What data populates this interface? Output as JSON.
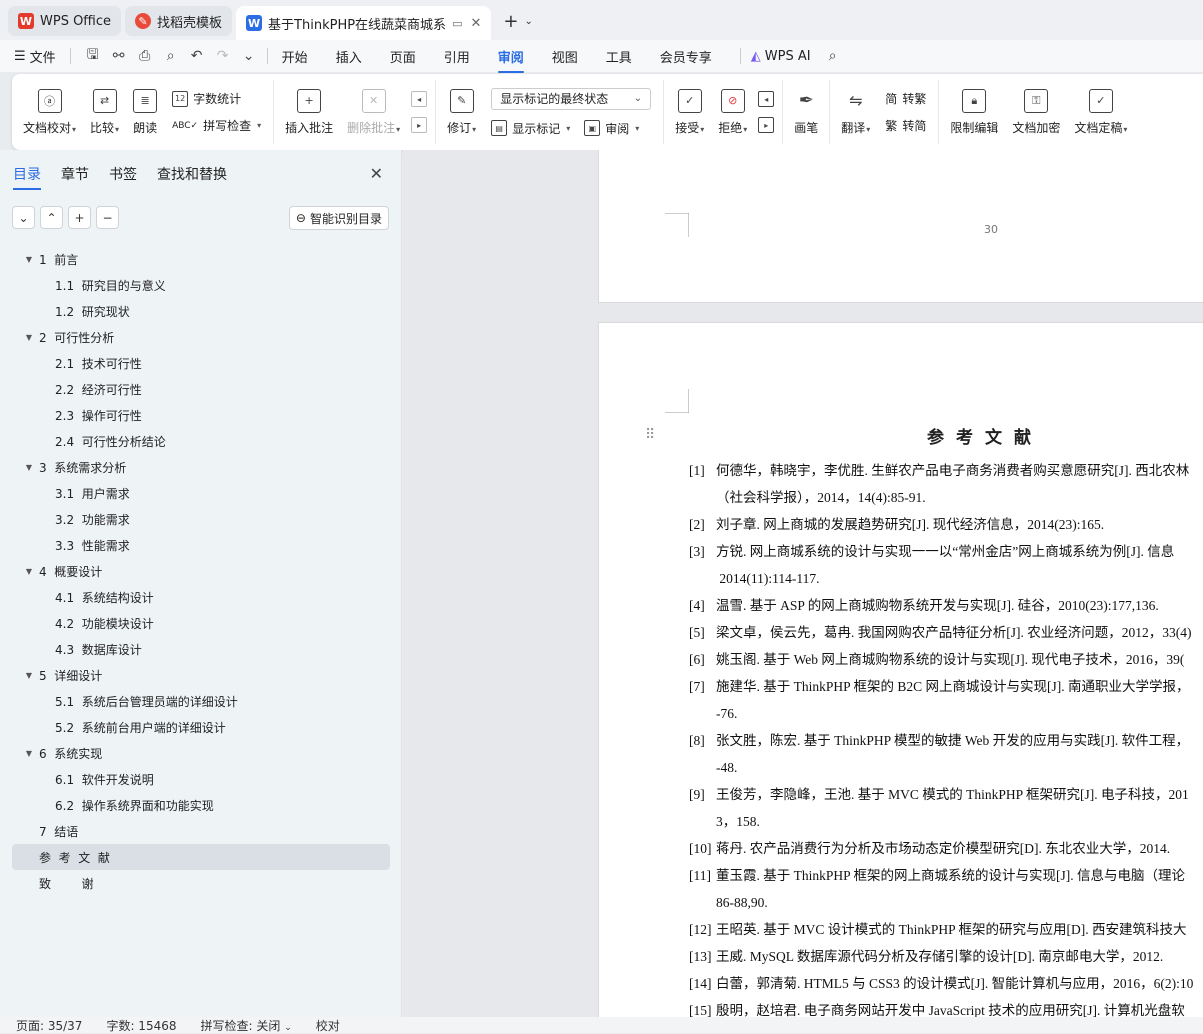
{
  "tabs": [
    {
      "label": "WPS Office",
      "icon": "wps-logo-icon",
      "color": "#e23b2e"
    },
    {
      "label": "找稻壳模板",
      "icon": "docer-icon",
      "color": "#e84b3c"
    },
    {
      "label": "基于ThinkPHP在线蔬菜商城系",
      "icon": "word-doc-icon",
      "color": "#2b6de5",
      "active": true
    }
  ],
  "menu": {
    "file_label": "文件",
    "tabs": [
      "开始",
      "插入",
      "页面",
      "引用",
      "审阅",
      "视图",
      "工具",
      "会员专享"
    ],
    "selected_tab": "审阅",
    "ai_label": "WPS AI"
  },
  "ribbon": {
    "proof_label": "文档校对",
    "compare_label": "比较",
    "read_label": "朗读",
    "wordcount_label": "字数统计",
    "spellcheck_label": "拼写检查",
    "insert_comment_label": "插入批注",
    "delete_comment_label": "删除批注",
    "revise_label": "修订",
    "markup_select": "显示标记的最终状态",
    "show_markup_label": "显示标记",
    "review_label": "审阅",
    "accept_label": "接受",
    "reject_label": "拒绝",
    "pen_label": "画笔",
    "translate_label": "翻译",
    "to_trad_label": "转繁",
    "to_simp_label": "转简",
    "restrict_label": "限制编辑",
    "encrypt_label": "文档加密",
    "finalize_label": "文档定稿"
  },
  "sidebar": {
    "tabs": [
      "目录",
      "章节",
      "书签",
      "查找和替换"
    ],
    "selected_tab": "目录",
    "smart_label": "智能识别目录",
    "toc": [
      {
        "label": "1  前言",
        "level": 1
      },
      {
        "label": "1.1  研究目的与意义",
        "level": 2
      },
      {
        "label": "1.2  研究现状",
        "level": 2
      },
      {
        "label": "2  可行性分析",
        "level": 1
      },
      {
        "label": "2.1  技术可行性",
        "level": 2
      },
      {
        "label": "2.2  经济可行性",
        "level": 2
      },
      {
        "label": "2.3  操作可行性",
        "level": 2
      },
      {
        "label": "2.4  可行性分析结论",
        "level": 2
      },
      {
        "label": "3  系统需求分析",
        "level": 1
      },
      {
        "label": "3.1  用户需求",
        "level": 2
      },
      {
        "label": "3.2  功能需求",
        "level": 2
      },
      {
        "label": "3.3  性能需求",
        "level": 2
      },
      {
        "label": "4  概要设计",
        "level": 1
      },
      {
        "label": "4.1  系统结构设计",
        "level": 2
      },
      {
        "label": "4.2  功能模块设计",
        "level": 2
      },
      {
        "label": "4.3  数据库设计",
        "level": 2
      },
      {
        "label": "5  详细设计",
        "level": 1
      },
      {
        "label": "5.1  系统后台管理员端的详细设计",
        "level": 2
      },
      {
        "label": "5.2  系统前台用户端的详细设计",
        "level": 2
      },
      {
        "label": "6  系统实现",
        "level": 1
      },
      {
        "label": "6.1  软件开发说明",
        "level": 2
      },
      {
        "label": "6.2  操作系统界面和功能实现",
        "level": 2
      },
      {
        "label": "7  结语",
        "level": 1,
        "leaf": true
      },
      {
        "label": "参  考  文  献",
        "level": 1,
        "leaf": true,
        "selected": true
      },
      {
        "label": "致        谢",
        "level": 1,
        "leaf": true
      }
    ]
  },
  "document": {
    "page_number": "30",
    "ref_title": "参考文献",
    "references": [
      {
        "num": "[1]",
        "lines": [
          "何德华，韩晓宇，李优胜. 生鲜农产品电子商务消费者购买意愿研究[J]. 西北农林",
          "（社会科学报），2014，14(4):85-91."
        ]
      },
      {
        "num": "[2]",
        "lines": [
          "刘子章. 网上商城的发展趋势研究[J]. 现代经济信息，2014(23):165."
        ]
      },
      {
        "num": "[3]",
        "lines": [
          "方锐. 网上商城系统的设计与实现一一以“常州金店”网上商城系统为例[J]. 信息",
          " 2014(11):114-117."
        ]
      },
      {
        "num": "[4]",
        "lines": [
          "温雪. 基于 ASP 的网上商城购物系统开发与实现[J]. 硅谷，2010(23):177,136."
        ]
      },
      {
        "num": "[5]",
        "lines": [
          "梁文卓，侯云先，葛冉. 我国网购农产品特征分析[J]. 农业经济问题，2012，33(4)"
        ]
      },
      {
        "num": "[6]",
        "lines": [
          "姚玉阁. 基于 Web 网上商城购物系统的设计与实现[J]. 现代电子技术，2016，39("
        ]
      },
      {
        "num": "[7]",
        "lines": [
          "施建华. 基于 ThinkPHP 框架的 B2C 网上商城设计与实现[J]. 南通职业大学学报，",
          "-76."
        ]
      },
      {
        "num": "[8]",
        "lines": [
          "张文胜，陈宏. 基于 ThinkPHP 模型的敏捷 Web 开发的应用与实践[J]. 软件工程，",
          "-48."
        ]
      },
      {
        "num": "[9]",
        "lines": [
          "王俊芳，李隐峰，王池. 基于 MVC 模式的 ThinkPHP 框架研究[J]. 电子科技，201",
          "3，158."
        ]
      },
      {
        "num": "[10]",
        "lines": [
          "蒋丹. 农产品消费行为分析及市场动态定价模型研究[D]. 东北农业大学，2014."
        ]
      },
      {
        "num": "[11]",
        "lines": [
          "董玉霞. 基于 ThinkPHP 框架的网上商城系统的设计与实现[J]. 信息与电脑（理论",
          "86-88,90."
        ]
      },
      {
        "num": "[12]",
        "lines": [
          "王昭英. 基于 MVC 设计模式的 ThinkPHP 框架的研究与应用[D]. 西安建筑科技大"
        ]
      },
      {
        "num": "[13]",
        "lines": [
          "王威. MySQL 数据库源代码分析及存储引擎的设计[D]. 南京邮电大学，2012."
        ]
      },
      {
        "num": "[14]",
        "lines": [
          "白蕾，郭清菊. HTML5 与 CSS3 的设计模式[J]. 智能计算机与应用，2016，6(2):10"
        ]
      },
      {
        "num": "[15]",
        "lines": [
          "殷明，赵培君. 电子商务网站开发中 JavaScript 技术的应用研究[J]. 计算机光盘软"
        ]
      }
    ]
  },
  "status": {
    "page": "页面: 35/37",
    "words": "字数: 15468",
    "spell": "拼写检查: 关闭",
    "proof": "校对"
  },
  "colors": {
    "accent": "#2b6de5"
  }
}
